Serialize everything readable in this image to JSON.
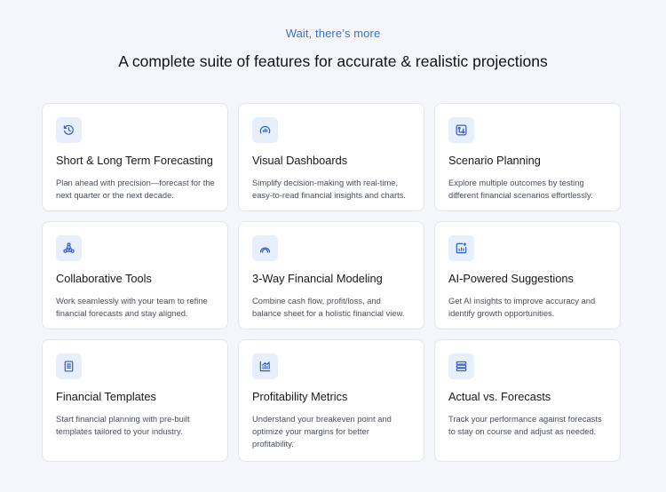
{
  "header": {
    "eyebrow": "Wait, there’s more",
    "title": "A complete suite of features for accurate & realistic projections"
  },
  "colors": {
    "accent": "#3a6fd1",
    "icon_bg": "#e8effc",
    "card_bg": "#ffffff",
    "page_bg": "#f5f6f9"
  },
  "features": [
    {
      "icon": "clock-refresh-icon",
      "title": "Short & Long Term Forecasting",
      "description": "Plan ahead with precision—forecast for the next quarter or the next decade."
    },
    {
      "icon": "dashboard-gauge-icon",
      "title": "Visual Dashboards",
      "description": "Simplify decision-making with real-time, easy-to-read financial insights and charts."
    },
    {
      "icon": "scenario-branch-icon",
      "title": "Scenario Planning",
      "description": "Explore multiple outcomes by testing different financial scenarios effortlessly."
    },
    {
      "icon": "team-users-icon",
      "title": "Collaborative Tools",
      "description": "Work seamlessly with your team to refine financial forecasts and stay aligned."
    },
    {
      "icon": "model-cycle-icon",
      "title": "3-Way Financial Modeling",
      "description": "Combine cash flow, profit/loss, and balance sheet for a holistic financial view."
    },
    {
      "icon": "ai-chart-icon",
      "title": "AI-Powered Suggestions",
      "description": "Get AI insights to improve accuracy and identify growth opportunities."
    },
    {
      "icon": "document-template-icon",
      "title": "Financial Templates",
      "description": "Start financial planning with pre-built templates tailored to your industry."
    },
    {
      "icon": "bar-chart-icon",
      "title": "Profitability Metrics",
      "description": "Understand your breakeven point and optimize your margins for better profitability."
    },
    {
      "icon": "stacked-layers-icon",
      "title": "Actual vs. Forecasts",
      "description": "Track your performance against forecasts to stay on course and adjust as needed."
    }
  ]
}
